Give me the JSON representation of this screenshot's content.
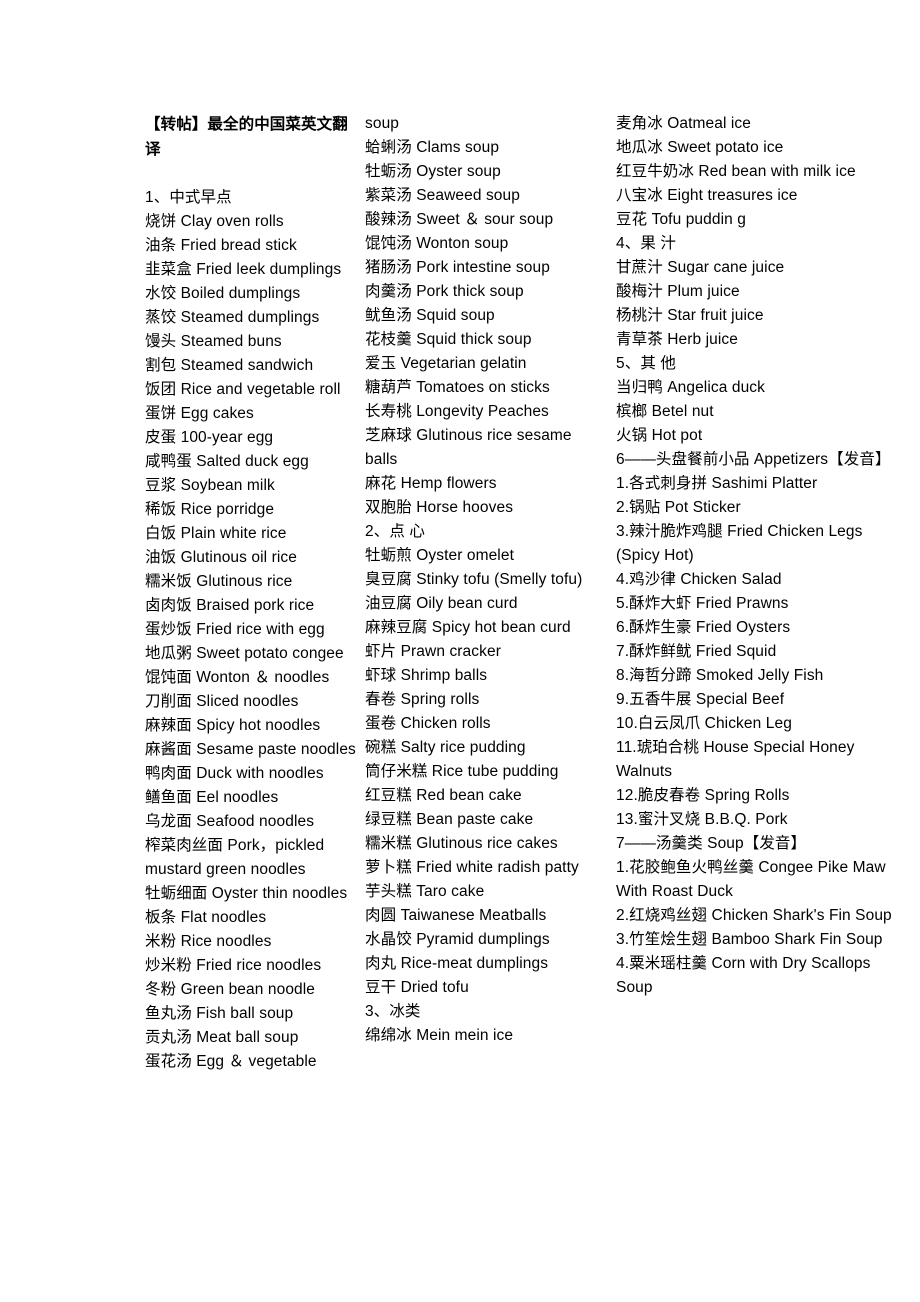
{
  "document": {
    "title": "【转帖】最全的中国菜英文翻译",
    "background_color": "#ffffff",
    "text_color": "#000000"
  },
  "columns": [
    {
      "name": "column-1",
      "lines": [
        {
          "text": "【转帖】最全的中国菜英文翻译",
          "style": "title"
        },
        {
          "text": "",
          "style": "blank"
        },
        {
          "text": "1、中式早点",
          "style": "normal"
        },
        {
          "text": "烧饼  Clay oven rolls",
          "style": "normal"
        },
        {
          "text": "油条  Fried bread stick",
          "style": "normal"
        },
        {
          "text": "韭菜盒  Fried leek dumplings",
          "style": "normal"
        },
        {
          "text": "水饺  Boiled dumplings",
          "style": "normal"
        },
        {
          "text": "蒸饺  Steamed dumplings",
          "style": "normal"
        },
        {
          "text": "馒头  Steamed buns",
          "style": "normal"
        },
        {
          "text": "割包  Steamed sandwich",
          "style": "normal"
        },
        {
          "text": "饭团  Rice and vegetable roll",
          "style": "normal"
        },
        {
          "text": "蛋饼  Egg cakes",
          "style": "normal"
        },
        {
          "text": "皮蛋  100-year egg",
          "style": "normal"
        },
        {
          "text": "咸鸭蛋  Salted duck egg",
          "style": "normal"
        },
        {
          "text": "豆浆  Soybean milk",
          "style": "normal"
        },
        {
          "text": "稀饭  Rice porridge",
          "style": "normal"
        },
        {
          "text": "白饭  Plain white rice",
          "style": "normal"
        },
        {
          "text": "油饭  Glutinous oil rice",
          "style": "normal"
        },
        {
          "text": "糯米饭  Glutinous rice",
          "style": "normal"
        },
        {
          "text": "卤肉饭  Braised pork rice",
          "style": "normal"
        },
        {
          "text": "蛋炒饭  Fried rice with egg",
          "style": "normal"
        },
        {
          "text": "地瓜粥  Sweet potato congee",
          "style": "normal"
        },
        {
          "text": "馄饨面  Wonton ＆ noodles",
          "style": "normal"
        },
        {
          "text": "刀削面  Sliced noodles",
          "style": "normal"
        },
        {
          "text": "麻辣面  Spicy hot noodles",
          "style": "normal"
        },
        {
          "text": "麻酱面  Sesame paste noodles",
          "style": "normal"
        },
        {
          "text": "鸭肉面  Duck with noodles",
          "style": "normal"
        },
        {
          "text": "鳝鱼面  Eel noodles",
          "style": "normal"
        },
        {
          "text": "乌龙面  Seafood noodles",
          "style": "normal"
        },
        {
          "text": "榨菜肉丝面  Pork，pickled mustard green noodles",
          "style": "normal"
        },
        {
          "text": "牡蛎细面  Oyster thin noodles",
          "style": "normal"
        },
        {
          "text": "板条  Flat noodles",
          "style": "normal"
        },
        {
          "text": "米粉  Rice noodles",
          "style": "normal"
        },
        {
          "text": "炒米粉  Fried rice noodles",
          "style": "normal"
        },
        {
          "text": "冬粉  Green bean noodle",
          "style": "normal"
        },
        {
          "text": "鱼丸汤  Fish ball soup",
          "style": "normal"
        },
        {
          "text": "贡丸汤  Meat ball soup",
          "style": "normal"
        },
        {
          "text": "蛋花汤  Egg ＆ vegetable",
          "style": "normal"
        }
      ]
    },
    {
      "name": "column-2",
      "lines": [
        {
          "text": "soup",
          "style": "normal"
        },
        {
          "text": "蛤蜊汤  Clams soup",
          "style": "normal"
        },
        {
          "text": "牡蛎汤  Oyster soup",
          "style": "normal"
        },
        {
          "text": "紫菜汤  Seaweed soup",
          "style": "normal"
        },
        {
          "text": "酸辣汤  Sweet ＆ sour soup",
          "style": "normal"
        },
        {
          "text": "馄饨汤  Wonton soup",
          "style": "normal"
        },
        {
          "text": "猪肠汤  Pork intestine soup",
          "style": "normal"
        },
        {
          "text": "肉羹汤  Pork thick soup",
          "style": "normal"
        },
        {
          "text": "鱿鱼汤  Squid soup",
          "style": "normal"
        },
        {
          "text": "花枝羹  Squid thick soup",
          "style": "normal"
        },
        {
          "text": "爱玉  Vegetarian gelatin",
          "style": "normal"
        },
        {
          "text": "糖葫芦  Tomatoes on sticks",
          "style": "normal"
        },
        {
          "text": "长寿桃  Longevity Peaches",
          "style": "normal"
        },
        {
          "text": "芝麻球  Glutinous rice sesame balls",
          "style": "normal"
        },
        {
          "text": "麻花  Hemp flowers",
          "style": "normal"
        },
        {
          "text": "双胞胎  Horse hooves",
          "style": "normal"
        },
        {
          "text": "2、点 心",
          "style": "normal"
        },
        {
          "text": "牡蛎煎  Oyster omelet",
          "style": "normal"
        },
        {
          "text": "臭豆腐  Stinky tofu (Smelly tofu)",
          "style": "normal"
        },
        {
          "text": "油豆腐  Oily bean curd",
          "style": "normal"
        },
        {
          "text": "麻辣豆腐  Spicy hot bean curd",
          "style": "normal"
        },
        {
          "text": "虾片  Prawn cracker",
          "style": "normal"
        },
        {
          "text": "虾球  Shrimp balls",
          "style": "normal"
        },
        {
          "text": "春卷  Spring rolls",
          "style": "normal"
        },
        {
          "text": "蛋卷  Chicken rolls",
          "style": "normal"
        },
        {
          "text": "碗糕  Salty rice pudding",
          "style": "normal"
        },
        {
          "text": "筒仔米糕  Rice tube pudding",
          "style": "normal"
        },
        {
          "text": "红豆糕  Red bean cake",
          "style": "normal"
        },
        {
          "text": "绿豆糕  Bean paste cake",
          "style": "normal"
        },
        {
          "text": "糯米糕  Glutinous rice cakes",
          "style": "normal"
        },
        {
          "text": "萝卜糕  Fried white radish patty",
          "style": "normal"
        },
        {
          "text": "芋头糕  Taro cake",
          "style": "normal"
        },
        {
          "text": "肉圆  Taiwanese Meatballs",
          "style": "normal"
        },
        {
          "text": "水晶饺  Pyramid dumplings",
          "style": "normal"
        },
        {
          "text": "肉丸  Rice-meat dumplings",
          "style": "normal"
        },
        {
          "text": "豆干  Dried tofu",
          "style": "normal"
        },
        {
          "text": "3、冰类",
          "style": "normal"
        },
        {
          "text": "绵绵冰  Mein mein ice",
          "style": "normal"
        }
      ]
    },
    {
      "name": "column-3",
      "lines": [
        {
          "text": "麦角冰  Oatmeal ice",
          "style": "normal"
        },
        {
          "text": "地瓜冰  Sweet potato ice",
          "style": "normal"
        },
        {
          "text": "红豆牛奶冰  Red bean with milk ice",
          "style": "normal"
        },
        {
          "text": "八宝冰  Eight treasures ice",
          "style": "normal"
        },
        {
          "text": "豆花  Tofu puddin g",
          "style": "normal"
        },
        {
          "text": "4、果 汁",
          "style": "normal"
        },
        {
          "text": "甘蔗汁  Sugar cane juice",
          "style": "normal"
        },
        {
          "text": "酸梅汁  Plum juice",
          "style": "normal"
        },
        {
          "text": "杨桃汁  Star fruit juice",
          "style": "normal"
        },
        {
          "text": "青草茶  Herb juice",
          "style": "normal"
        },
        {
          "text": "5、其 他",
          "style": "normal"
        },
        {
          "text": "当归鸭  Angelica duck",
          "style": "normal"
        },
        {
          "text": "槟榔  Betel nut",
          "style": "normal"
        },
        {
          "text": "火锅  Hot pot",
          "style": "normal"
        },
        {
          "text": "6——头盘餐前小品 Appetizers【发音】",
          "style": "normal"
        },
        {
          "text": "1.各式刺身拼 Sashimi Platter",
          "style": "normal"
        },
        {
          "text": "2.锅贴 Pot Sticker",
          "style": "normal"
        },
        {
          "text": "3.辣汁脆炸鸡腿 Fried Chicken Legs (Spicy Hot)",
          "style": "normal"
        },
        {
          "text": "4.鸡沙律 Chicken Salad",
          "style": "normal"
        },
        {
          "text": "5.酥炸大虾 Fried Prawns",
          "style": "normal"
        },
        {
          "text": "6.酥炸生豪 Fried Oysters",
          "style": "normal"
        },
        {
          "text": "7.酥炸鲜鱿 Fried Squid",
          "style": "normal"
        },
        {
          "text": "8.海哲分蹄 Smoked Jelly Fish",
          "style": "normal"
        },
        {
          "text": "9.五香牛展 Special Beef",
          "style": "normal"
        },
        {
          "text": "10.白云凤爪 Chicken Leg",
          "style": "normal"
        },
        {
          "text": "11.琥珀合桃 House Special Honey Walnuts",
          "style": "normal"
        },
        {
          "text": "12.脆皮春卷 Spring Rolls",
          "style": "normal"
        },
        {
          "text": "13.蜜汁叉烧 B.B.Q. Pork",
          "style": "normal"
        },
        {
          "text": "7——汤羹类 Soup【发音】",
          "style": "normal"
        },
        {
          "text": "1.花胶鲍鱼火鸭丝羹 Congee Pike Maw With Roast Duck",
          "style": "normal"
        },
        {
          "text": "2.红烧鸡丝翅 Chicken Shark's Fin Soup",
          "style": "normal"
        },
        {
          "text": "3.竹笙烩生翅 Bamboo Shark Fin Soup",
          "style": "normal"
        },
        {
          "text": "4.粟米瑶柱羹 Corn with Dry Scallops Soup",
          "style": "normal"
        }
      ]
    }
  ]
}
